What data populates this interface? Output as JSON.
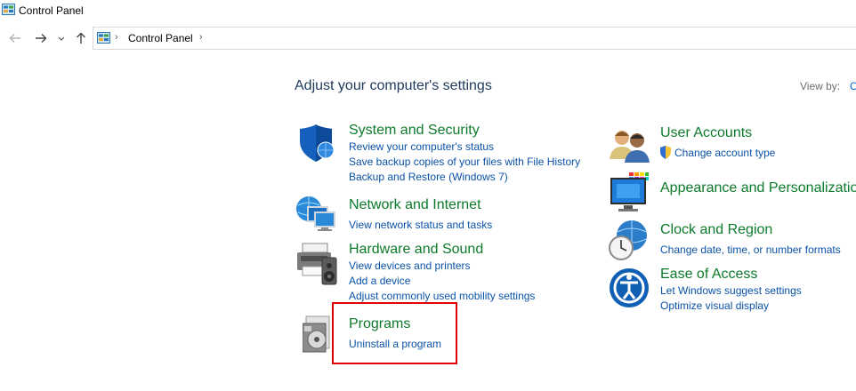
{
  "window": {
    "title": "Control Panel"
  },
  "nav": {
    "back_icon": "arrow-left-icon",
    "forward_icon": "arrow-right-icon",
    "recent_icon": "chevron-down-icon",
    "up_icon": "arrow-up-icon",
    "breadcrumb": [
      "Control Panel"
    ]
  },
  "main": {
    "heading": "Adjust your computer's settings",
    "view_by_label": "View by:",
    "view_by_value": "C"
  },
  "categories": {
    "system_security": {
      "title": "System and Security",
      "links": [
        "Review your computer's status",
        "Save backup copies of your files with File History",
        "Backup and Restore (Windows 7)"
      ]
    },
    "network_internet": {
      "title": "Network and Internet",
      "links": [
        "View network status and tasks"
      ]
    },
    "hardware_sound": {
      "title": "Hardware and Sound",
      "links": [
        "View devices and printers",
        "Add a device",
        "Adjust commonly used mobility settings"
      ]
    },
    "programs": {
      "title": "Programs",
      "links": [
        "Uninstall a program"
      ]
    },
    "user_accounts": {
      "title": "User Accounts",
      "links": [
        "Change account type"
      ]
    },
    "appearance": {
      "title": "Appearance and Personalization",
      "links": []
    },
    "clock_region": {
      "title": "Clock and Region",
      "links": [
        "Change date, time, or number formats"
      ]
    },
    "ease_access": {
      "title": "Ease of Access",
      "links": [
        "Let Windows suggest settings",
        "Optimize visual display"
      ]
    }
  },
  "colors": {
    "category_title": "#0c7a2a",
    "link": "#0a52a8",
    "heading": "#1e395b",
    "highlight_box": "#e00000"
  }
}
